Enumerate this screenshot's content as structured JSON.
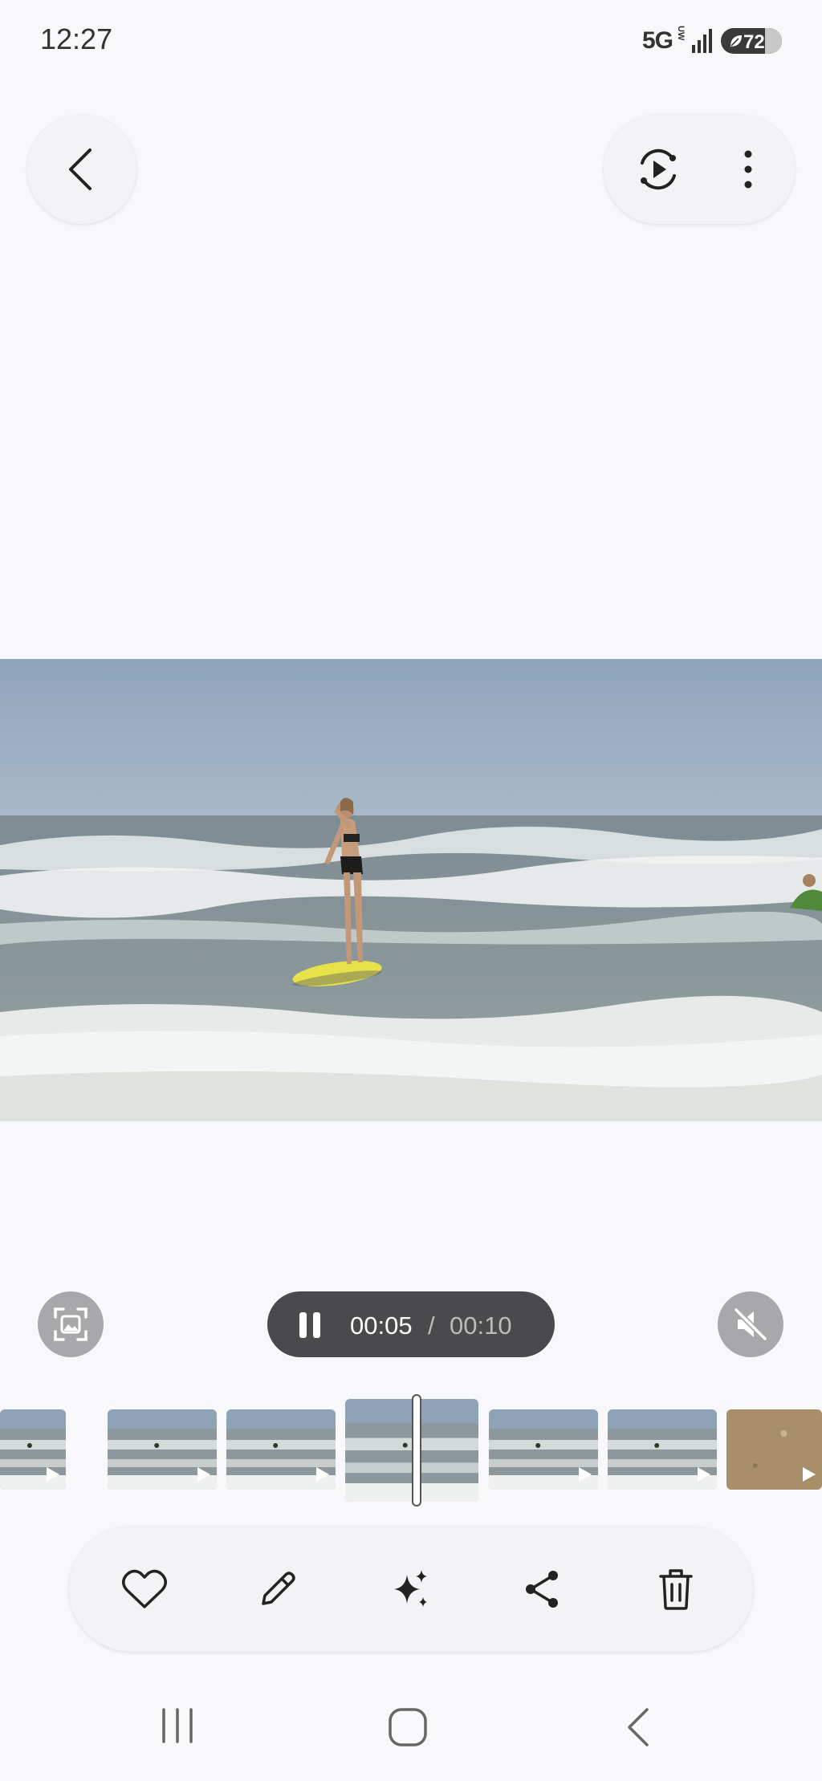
{
  "status_bar": {
    "time": "12:27",
    "network": "5G",
    "network_sub": "UW",
    "battery": "72",
    "battery_level": 0.72
  },
  "top_bar": {
    "back_icon": "chevron-left-icon",
    "slideshow_icon": "play-cycle-icon",
    "more_icon": "more-vertical-icon"
  },
  "viewer": {
    "media_type": "video",
    "scene": "surfer-on-yellow-board"
  },
  "playback": {
    "current_time": "00:05",
    "separator": "/",
    "total_time": "00:10",
    "state": "playing",
    "muted": true
  },
  "filmstrip": {
    "items": [
      {
        "type": "video"
      },
      {
        "type": "video"
      },
      {
        "type": "video"
      },
      {
        "type": "video",
        "current": true
      },
      {
        "type": "video"
      },
      {
        "type": "video"
      },
      {
        "type": "video"
      }
    ],
    "scrub_position": 0.5
  },
  "actions": [
    {
      "icon": "heart-icon",
      "name": "favorite"
    },
    {
      "icon": "pencil-icon",
      "name": "edit"
    },
    {
      "icon": "sparkle-icon",
      "name": "enhance"
    },
    {
      "icon": "share-icon",
      "name": "share"
    },
    {
      "icon": "trash-icon",
      "name": "delete"
    }
  ],
  "nav_bar": {
    "recent_icon": "recent-apps-icon",
    "home_icon": "home-icon",
    "back_icon": "back-icon"
  },
  "colors": {
    "background": "#f8f8fb",
    "pill": "#4a4a4c",
    "round_button": "#a8a8ab",
    "icon": "#222222"
  }
}
